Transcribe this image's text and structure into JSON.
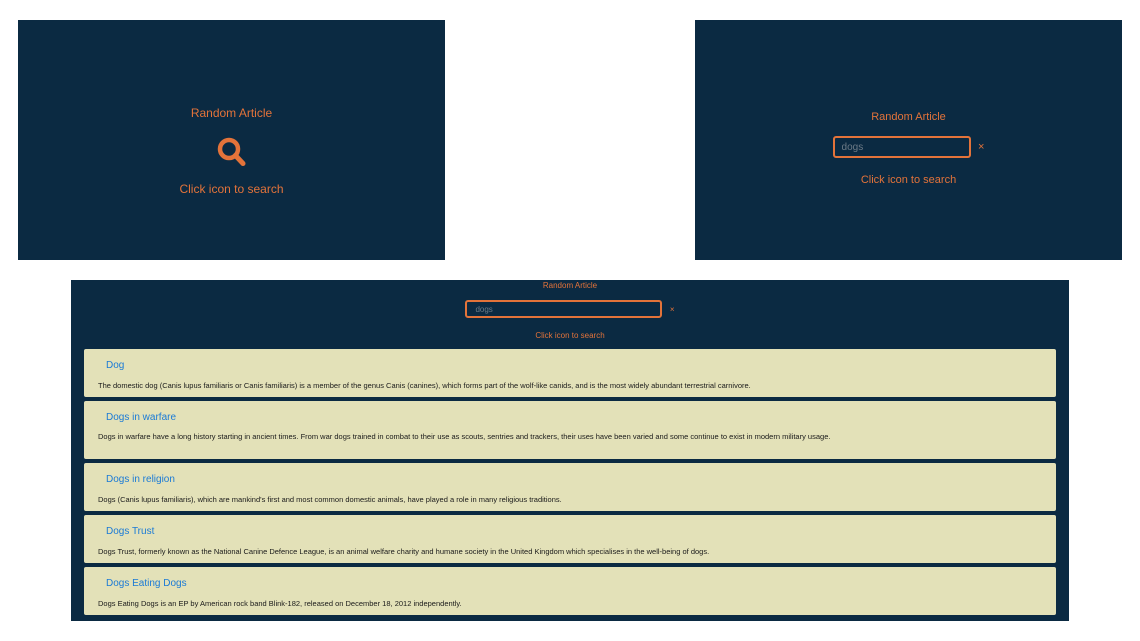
{
  "colors": {
    "panel_background": "#0b2a42",
    "accent": "#e3733a",
    "card_background": "#e3e1b8",
    "result_title": "#1a7ad6"
  },
  "state_initial": {
    "random_label": "Random Article",
    "icon": "search-icon",
    "hint": "Click icon to search"
  },
  "state_input": {
    "random_label": "Random Article",
    "search_value": "dogs",
    "clear_label": "×",
    "hint": "Click icon to search"
  },
  "state_results": {
    "random_label": "Random Article",
    "search_value": "dogs",
    "clear_label": "×",
    "hint": "Click icon to search",
    "results": [
      {
        "title": "Dog",
        "snippet": "The domestic dog (Canis lupus familiaris or Canis familiaris) is a member of the genus Canis (canines), which forms part of the wolf-like canids, and is the most widely abundant terrestrial carnivore."
      },
      {
        "title": "Dogs in warfare",
        "snippet": "Dogs in warfare have a long history starting in ancient times. From war dogs trained in combat to their use as scouts, sentries and trackers, their uses have been varied and some continue to exist in modern military usage."
      },
      {
        "title": "Dogs in religion",
        "snippet": "Dogs (Canis lupus familiaris), which are mankind's first and most common domestic animals, have played a role in many religious traditions."
      },
      {
        "title": "Dogs Trust",
        "snippet": "Dogs Trust, formerly known as the National Canine Defence League, is an animal welfare charity and humane society in the United Kingdom which specialises in the well-being of dogs."
      },
      {
        "title": "Dogs Eating Dogs",
        "snippet": "Dogs Eating Dogs is an EP by American rock band Blink-182, released on December 18, 2012 independently."
      }
    ]
  }
}
